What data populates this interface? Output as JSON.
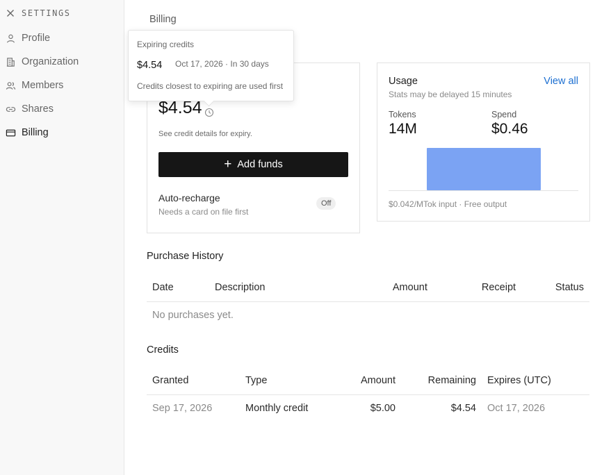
{
  "sidebar": {
    "title": "SETTINGS",
    "close_icon": "close-icon",
    "items": [
      {
        "label": "Profile",
        "icon": "user-icon"
      },
      {
        "label": "Organization",
        "icon": "building-icon"
      },
      {
        "label": "Members",
        "icon": "users-icon"
      },
      {
        "label": "Shares",
        "icon": "link-icon"
      },
      {
        "label": "Billing",
        "icon": "credit-card-icon",
        "active": true
      }
    ]
  },
  "page": {
    "title": "Billing"
  },
  "balance": {
    "amount": "$4.54",
    "note": "See credit details for expiry.",
    "add_funds_label": "Add funds",
    "auto_recharge": {
      "title": "Auto-recharge",
      "subtitle": "Needs a card on file first",
      "state": "Off"
    }
  },
  "tooltip": {
    "title": "Expiring credits",
    "amount": "$4.54",
    "detail": "Oct 17, 2026 · In 30 days",
    "note": "Credits closest to expiring are used first"
  },
  "usage": {
    "title": "Usage",
    "view_all_label": "View all",
    "subtitle": "Stats may be delayed 15 minutes",
    "tokens_label": "Tokens",
    "tokens_value": "14M",
    "spend_label": "Spend",
    "spend_value": "$0.46",
    "footnote": "$0.042/MTok input · Free output",
    "bar_color": "#7ba3f3"
  },
  "purchase_history": {
    "title": "Purchase History",
    "columns": [
      "Date",
      "Description",
      "Amount",
      "Receipt",
      "Status"
    ],
    "empty_text": "No purchases yet."
  },
  "credits": {
    "title": "Credits",
    "columns": [
      "Granted",
      "Type",
      "Amount",
      "Remaining",
      "Expires (UTC)"
    ],
    "rows": [
      {
        "granted": "Sep 17, 2026",
        "type": "Monthly credit",
        "amount": "$5.00",
        "remaining": "$4.54",
        "expires": "Oct 17, 2026"
      }
    ]
  }
}
